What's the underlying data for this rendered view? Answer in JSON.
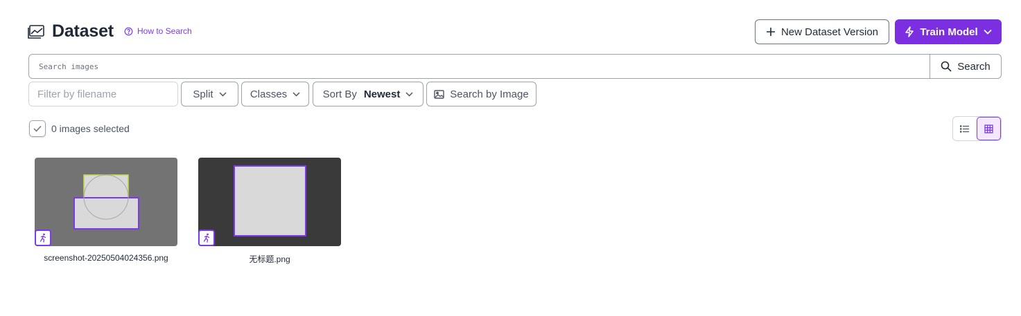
{
  "header": {
    "title": "Dataset",
    "how_to_label": "How to Search",
    "new_version_label": "New Dataset Version",
    "train_label": "Train Model"
  },
  "search": {
    "placeholder": "Search images",
    "button_label": "Search"
  },
  "filters": {
    "filename_placeholder": "Filter by filename",
    "split_label": "Split",
    "classes_label": "Classes",
    "sort_label": "Sort By",
    "sort_value": "Newest",
    "image_search_label": "Search by Image"
  },
  "selection": {
    "text": "0 images selected"
  },
  "images": [
    {
      "filename": "screenshot-20250504024356.png"
    },
    {
      "filename": "无标题.png"
    }
  ],
  "colors": {
    "accent": "#7c2fe0",
    "bbox_primary": "#7c3aed",
    "bbox_secondary": "#c7d94a"
  },
  "icons": {
    "title": "image-chart-icon",
    "how_to": "question-circle-icon",
    "new_version": "plus-icon",
    "train": "lightning-icon",
    "search": "search-icon",
    "image_search": "image-icon",
    "list_view": "list-icon",
    "grid_view": "grid-icon",
    "badge": "running-person-icon"
  }
}
